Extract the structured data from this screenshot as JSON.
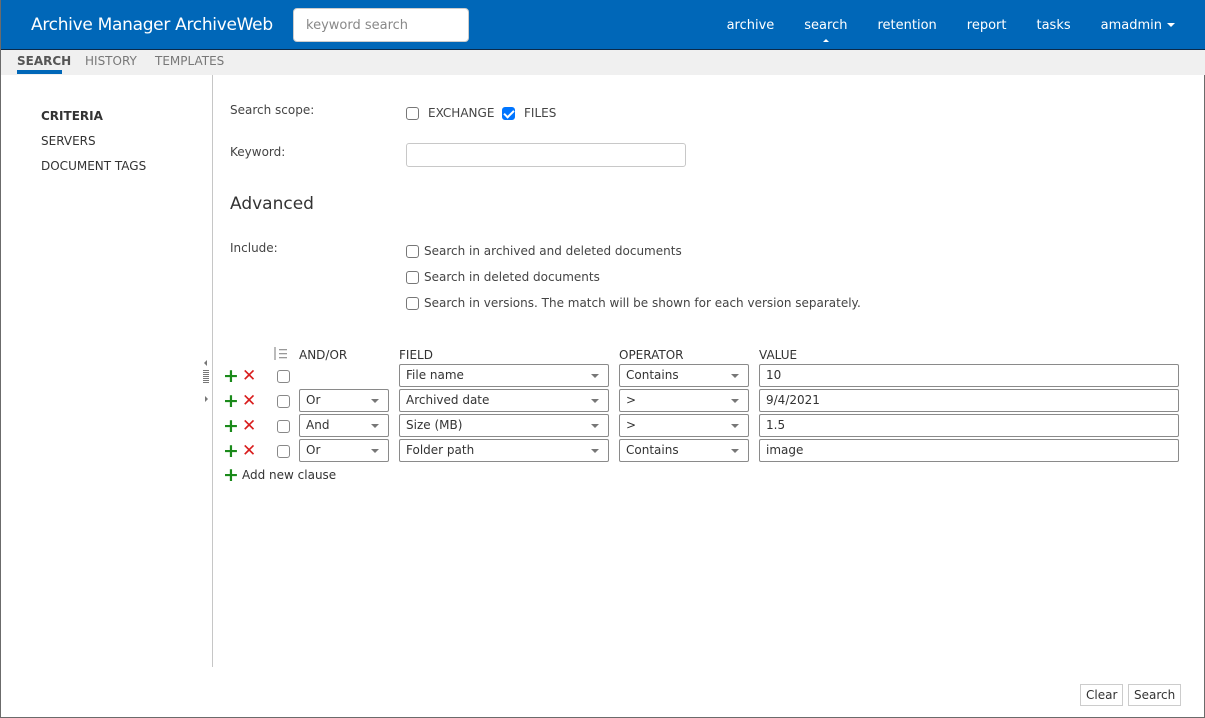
{
  "header": {
    "app_title": "Archive Manager ArchiveWeb",
    "search_placeholder": "keyword search",
    "nav": [
      {
        "label": "archive",
        "active": false
      },
      {
        "label": "search",
        "active": true
      },
      {
        "label": "retention",
        "active": false
      },
      {
        "label": "report",
        "active": false
      },
      {
        "label": "tasks",
        "active": false
      },
      {
        "label": "amadmin",
        "active": false,
        "dropdown": true
      }
    ]
  },
  "subtabs": [
    {
      "label": "SEARCH",
      "active": true
    },
    {
      "label": "HISTORY",
      "active": false
    },
    {
      "label": "TEMPLATES",
      "active": false
    }
  ],
  "sidebar": {
    "items": [
      {
        "label": "CRITERIA",
        "active": true
      },
      {
        "label": "SERVERS",
        "active": false
      },
      {
        "label": "DOCUMENT TAGS",
        "active": false
      }
    ]
  },
  "form": {
    "scope_label": "Search scope:",
    "scope_options": [
      {
        "label": "EXCHANGE",
        "checked": false
      },
      {
        "label": "FILES",
        "checked": true
      }
    ],
    "keyword_label": "Keyword:",
    "keyword_value": "",
    "advanced_heading": "Advanced",
    "include_label": "Include:",
    "include_options": [
      {
        "label": "Search in archived and deleted documents",
        "checked": false
      },
      {
        "label": "Search in deleted documents",
        "checked": false
      },
      {
        "label": "Search in versions. The match will be shown for each version separately.",
        "checked": false
      }
    ]
  },
  "clauses": {
    "headers": {
      "andor": "AND/OR",
      "field": "FIELD",
      "operator": "OPERATOR",
      "value": "VALUE"
    },
    "rows": [
      {
        "andor": null,
        "field": "File name",
        "operator": "Contains",
        "value": "10"
      },
      {
        "andor": "Or",
        "field": "Archived date",
        "operator": ">",
        "value": "9/4/2021"
      },
      {
        "andor": "And",
        "field": "Size (MB)",
        "operator": ">",
        "value": "1.5"
      },
      {
        "andor": "Or",
        "field": "Folder path",
        "operator": "Contains",
        "value": "image"
      }
    ],
    "add_label": "Add new clause",
    "icons": {
      "add": "+",
      "remove": "✕"
    }
  },
  "footer": {
    "clear_label": "Clear",
    "search_label": "Search"
  },
  "colors": {
    "brand": "#0067b8",
    "add_green": "#1a8a1a",
    "remove_red": "#d91d1d",
    "checkbox_checked": "#0075ff"
  }
}
